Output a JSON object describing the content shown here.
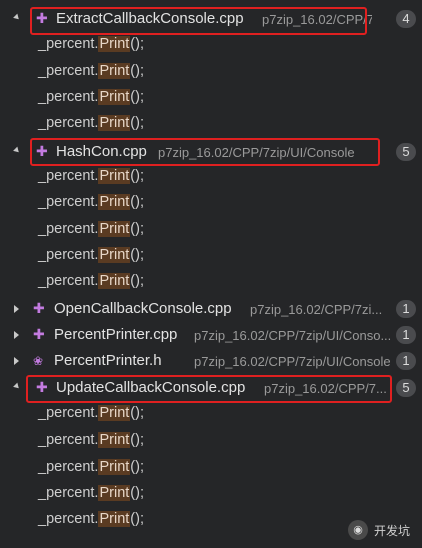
{
  "files": [
    {
      "name": "ExtractCallbackConsole.cpp",
      "path": "p7zip_16.02/CPP/7...",
      "count": "4",
      "icon": "cpp-file-icon",
      "expanded": true,
      "lines": [
        {
          "prefix": "_percent.",
          "match": "Print",
          "suffix": "();"
        },
        {
          "prefix": "_percent.",
          "match": "Print",
          "suffix": "();"
        },
        {
          "prefix": "_percent.",
          "match": "Print",
          "suffix": "();"
        },
        {
          "prefix": "_percent.",
          "match": "Print",
          "suffix": "();"
        }
      ]
    },
    {
      "name": "HashCon.cpp",
      "path": "p7zip_16.02/CPP/7zip/UI/Console",
      "count": "5",
      "icon": "cpp-file-icon",
      "expanded": true,
      "lines": [
        {
          "prefix": "_percent.",
          "match": "Print",
          "suffix": "();"
        },
        {
          "prefix": "_percent.",
          "match": "Print",
          "suffix": "();"
        },
        {
          "prefix": "_percent.",
          "match": "Print",
          "suffix": "();"
        },
        {
          "prefix": "_percent.",
          "match": "Print",
          "suffix": "();"
        },
        {
          "prefix": "_percent.",
          "match": "Print",
          "suffix": "();"
        }
      ]
    },
    {
      "name": "OpenCallbackConsole.cpp",
      "path": "p7zip_16.02/CPP/7zi...",
      "count": "1",
      "icon": "cpp-file-icon",
      "expanded": false,
      "lines": []
    },
    {
      "name": "PercentPrinter.cpp",
      "path": "p7zip_16.02/CPP/7zip/UI/Conso...",
      "count": "1",
      "icon": "cpp-file-icon",
      "expanded": false,
      "lines": []
    },
    {
      "name": "PercentPrinter.h",
      "path": "p7zip_16.02/CPP/7zip/UI/Console",
      "count": "1",
      "icon": "header-file-icon",
      "expanded": false,
      "lines": []
    },
    {
      "name": "UpdateCallbackConsole.cpp",
      "path": "p7zip_16.02/CPP/7...",
      "count": "5",
      "icon": "cpp-file-icon",
      "expanded": true,
      "lines": [
        {
          "prefix": "_percent.",
          "match": "Print",
          "suffix": "();"
        },
        {
          "prefix": "_percent.",
          "match": "Print",
          "suffix": "();"
        },
        {
          "prefix": "_percent.",
          "match": "Print",
          "suffix": "();"
        },
        {
          "prefix": "_percent.",
          "match": "Print",
          "suffix": "();"
        },
        {
          "prefix": "_percent.",
          "match": "Print",
          "suffix": "();"
        }
      ]
    }
  ],
  "watermark": {
    "label": "开发坑",
    "icon": "wechat-icon"
  },
  "colors": {
    "highlight_box": "#e02020",
    "match_bg": "#5a3b22",
    "icon": "#c37be0"
  }
}
